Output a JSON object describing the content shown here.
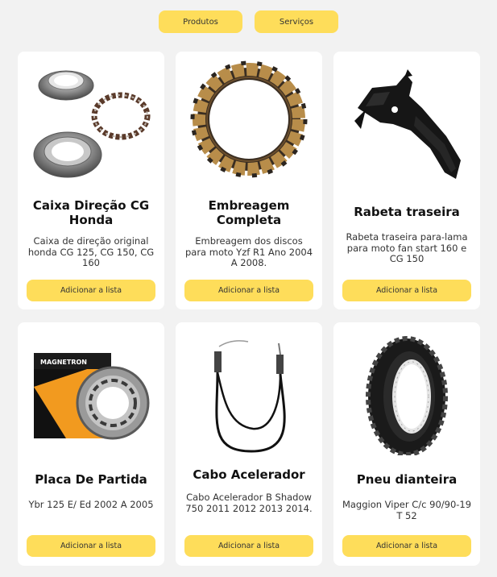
{
  "nav": {
    "items": [
      {
        "label": "Produtos"
      },
      {
        "label": "Serviços"
      }
    ]
  },
  "products": [
    {
      "title": "Caixa Direção CG Honda",
      "description": "Caixa de direção original honda CG 125, CG 150, CG 160",
      "button": "Adicionar a lista",
      "image_icon": "steering-bearing-icon"
    },
    {
      "title": "Embreagem Completa",
      "description": "Embreagem dos discos para moto Yzf R1 Ano 2004 A 2008.",
      "button": "Adicionar a lista",
      "image_icon": "clutch-disc-icon"
    },
    {
      "title": "Rabeta traseira",
      "description": "Rabeta traseira para-lama para moto fan start 160 e CG 150",
      "button": "Adicionar a lista",
      "image_icon": "rear-fender-icon"
    },
    {
      "title": "Placa De Partida",
      "description": "Ybr 125 E/ Ed 2002 A 2005",
      "button": "Adicionar a lista",
      "image_icon": "starter-plate-icon",
      "brand": "MAGNETRON"
    },
    {
      "title": "Cabo Acelerador",
      "description": "Cabo Acelerador B Shadow 750 2011 2012 2013 2014.",
      "button": "Adicionar a lista",
      "image_icon": "throttle-cable-icon"
    },
    {
      "title": "Pneu dianteira",
      "description": "Maggion Viper C/c 90/90-19 T 52",
      "button": "Adicionar a lista",
      "image_icon": "tire-icon"
    }
  ],
  "colors": {
    "accent": "#fedd5a",
    "background": "#f2f2f2",
    "card": "#ffffff"
  }
}
